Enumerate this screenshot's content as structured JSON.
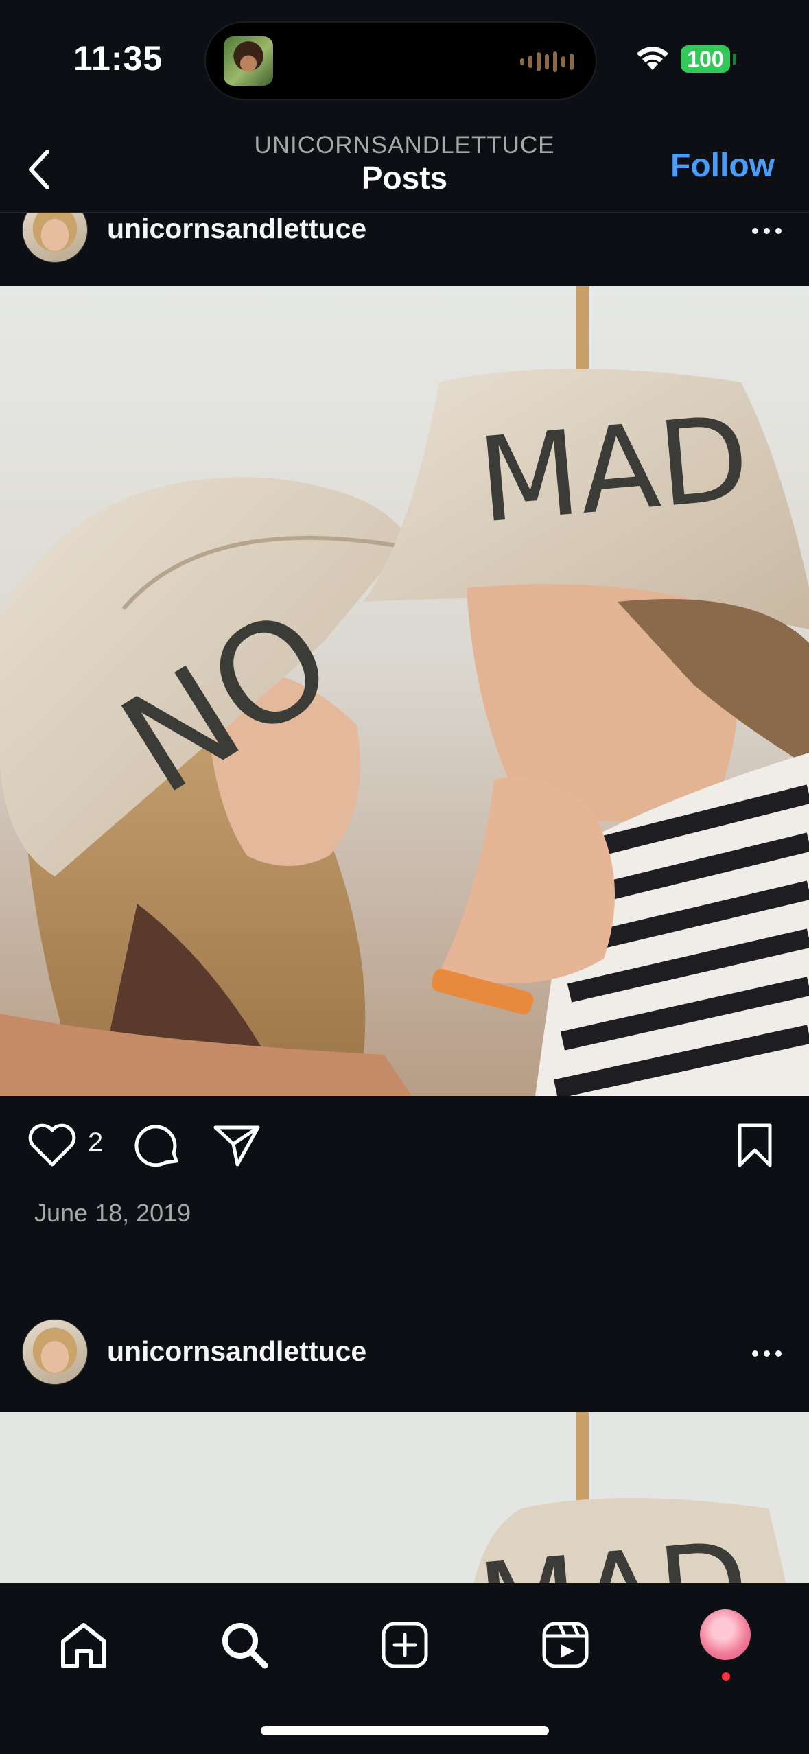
{
  "status_bar": {
    "time": "11:35",
    "battery": "100",
    "icons": [
      "wifi-icon",
      "battery-icon",
      "now-playing-icon"
    ]
  },
  "header": {
    "account": "UNICORNSANDLETTUCE",
    "title": "Posts",
    "follow_label": "Follow",
    "icons": [
      "back-chevron-icon"
    ]
  },
  "posts": [
    {
      "username": "unicornsandlettuce",
      "likes": "2",
      "date": "June 18, 2019",
      "photo_hat_text_left": "NO",
      "photo_hat_text_right": "MAD"
    },
    {
      "username": "unicornsandlettuce",
      "photo_hat_text_right": "MAD"
    }
  ],
  "tab_bar": {
    "items": [
      "home-icon",
      "search-icon",
      "create-icon",
      "reels-icon",
      "profile-avatar"
    ]
  },
  "colors": {
    "background": "#0c1014",
    "accent": "#4a9df8",
    "battery": "#34c759",
    "notification": "#ff3040"
  }
}
